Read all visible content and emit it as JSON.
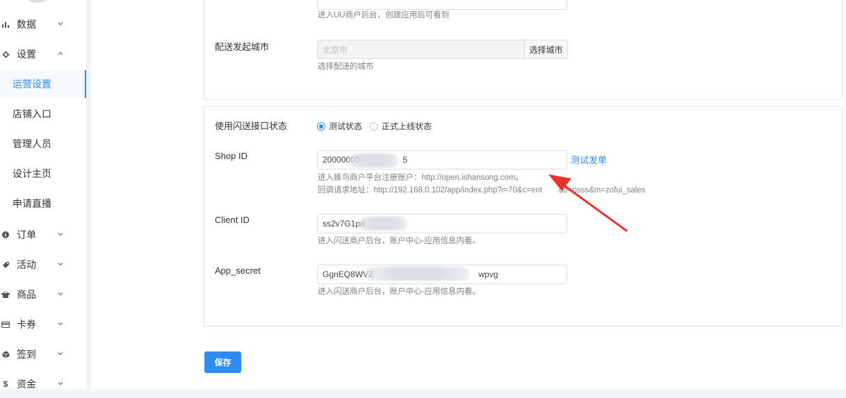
{
  "sidebar": {
    "items": [
      {
        "label": "数据",
        "icon": "bar-chart-icon",
        "expanded": false
      },
      {
        "label": "设置",
        "icon": "gear-icon",
        "expanded": true
      },
      {
        "label": "订单",
        "icon": "info-circle-icon",
        "expanded": false
      },
      {
        "label": "活动",
        "icon": "tag-icon",
        "expanded": false
      },
      {
        "label": "商品",
        "icon": "basket-icon",
        "expanded": false
      },
      {
        "label": "卡券",
        "icon": "card-icon",
        "expanded": false
      },
      {
        "label": "签到",
        "icon": "box-icon",
        "expanded": false
      },
      {
        "label": "资金",
        "icon": "dollar-icon",
        "expanded": false
      }
    ],
    "sub_items": [
      "运营设置",
      "店铺入口",
      "管理人员",
      "设计主页",
      "申请直播"
    ],
    "active_sub": "运营设置"
  },
  "uu_section": {
    "top_help": "进入UU商户后台，创建应用后可看到",
    "city_label": "配送发起城市",
    "city_value": "北京市",
    "city_button": "选择城市",
    "city_help": "选择配送的城市"
  },
  "flash_section": {
    "status_label": "使用闪送接口状态",
    "status_options": [
      "测试状态",
      "正式上线状态"
    ],
    "status_selected": "测试状态",
    "shop_id_label": "Shop ID",
    "shop_id_value": "20000000",
    "shop_id_value_tail": "5",
    "test_order_link": "测试发单",
    "shop_help_1": "进入蜂鸟商户平台注册账户：http://open.ishansong.com。",
    "shop_help_2": "回调请求地址：http://192.168.0.102/app/index.php?i=70&c=ent",
    "shop_help_2_tail": "do=psss&m=zofui_sales",
    "client_id_label": "Client ID",
    "client_id_value": "ss2v7G1pd",
    "client_help": "进入闪送商户后台，账户中心-应用信息内看。",
    "app_secret_label": "App_secret",
    "app_secret_value": "GgnEQ8WVZ",
    "app_secret_value_tail": "wpvg",
    "app_secret_help": "进入闪送商户后台，账户中心-应用信息内看。"
  },
  "save_button": "保存",
  "colors": {
    "accent": "#2d8cf0",
    "annotation_arrow": "#e8332e"
  }
}
